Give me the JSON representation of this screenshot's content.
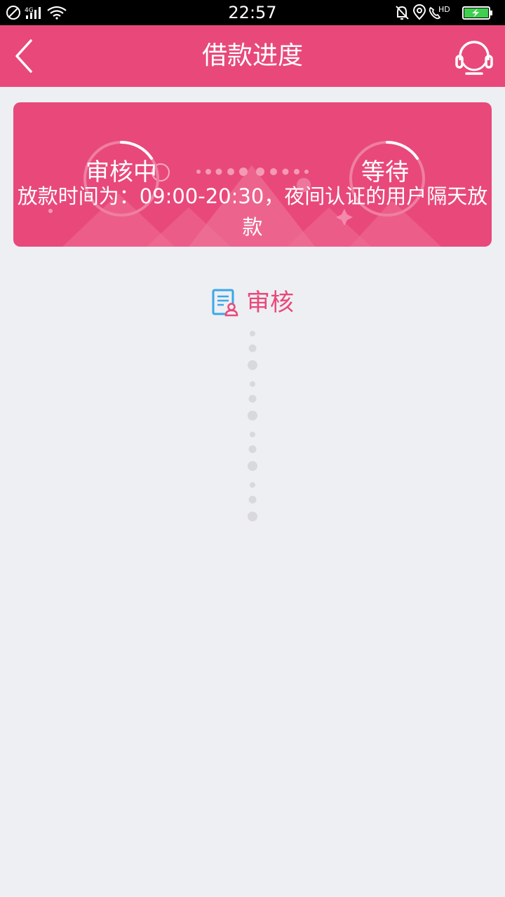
{
  "status_bar": {
    "time": "22:57",
    "network": "4G",
    "hd_label": "HD",
    "left_icons": [
      "no-sim-icon",
      "signal-icon",
      "wifi-icon"
    ],
    "right_icons": [
      "mute-icon",
      "location-icon",
      "call-hd-icon",
      "battery-charging-icon"
    ]
  },
  "header": {
    "title": "借款进度",
    "back_icon": "chevron-left-icon",
    "service_icon": "headset-icon"
  },
  "banner": {
    "step_left": "审核中",
    "step_right": "等待",
    "notice": "放款时间为：09:00-20:30，夜间认证的用户隔天放款"
  },
  "progress": {
    "title": "审核",
    "icon": "review-document-icon"
  },
  "colors": {
    "accent": "#e8497a",
    "background": "#eeeff3",
    "icon_blue": "#3aa7e8",
    "dot_gray": "#d9d9dc"
  }
}
